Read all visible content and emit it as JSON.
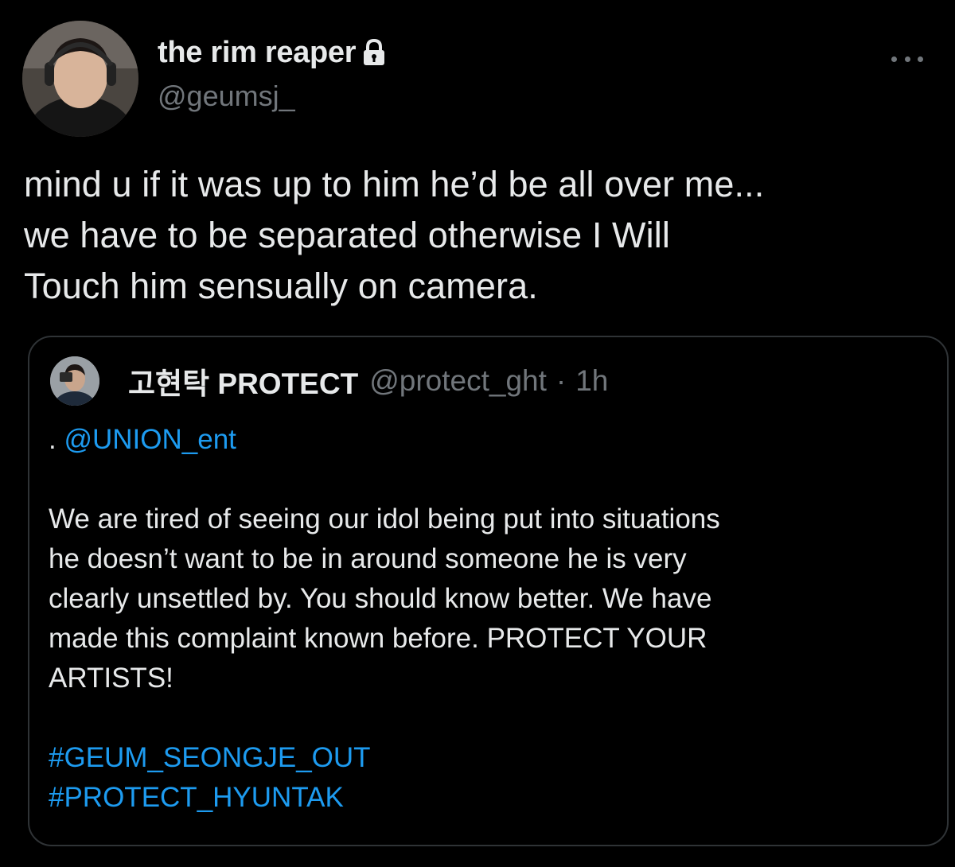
{
  "tweet": {
    "display_name": "the rim reaper",
    "handle": "@geumsj_",
    "text_line1": "mind u if it was up to him he’d be all over me...",
    "text_line2": "we have to be separated otherwise I Will",
    "text_line3": "Touch him sensually on camera."
  },
  "quote": {
    "display_name": "고현탁 PROTECT",
    "handle": "@protect_ght",
    "separator": "·",
    "time": "1h",
    "mention_prefix": ". ",
    "mention": "@UNION_ent",
    "body_line1": "We are tired of seeing our idol being put into situations",
    "body_line2": "he doesn’t want to be in around someone he is very",
    "body_line3": "clearly unsettled by. You should know better. We have",
    "body_line4": "made this complaint known before. PROTECT YOUR",
    "body_line5": "ARTISTS!",
    "hashtags": [
      "#GEUM_SEONGJE_OUT",
      "#PROTECT_HYUNTAK"
    ]
  },
  "icons": {
    "lock": "lock-icon",
    "more": "more-icon"
  },
  "colors": {
    "background": "#000000",
    "text": "#e7e9ea",
    "secondary": "#71767b",
    "link": "#1d9bf0",
    "border": "#2f3336"
  }
}
